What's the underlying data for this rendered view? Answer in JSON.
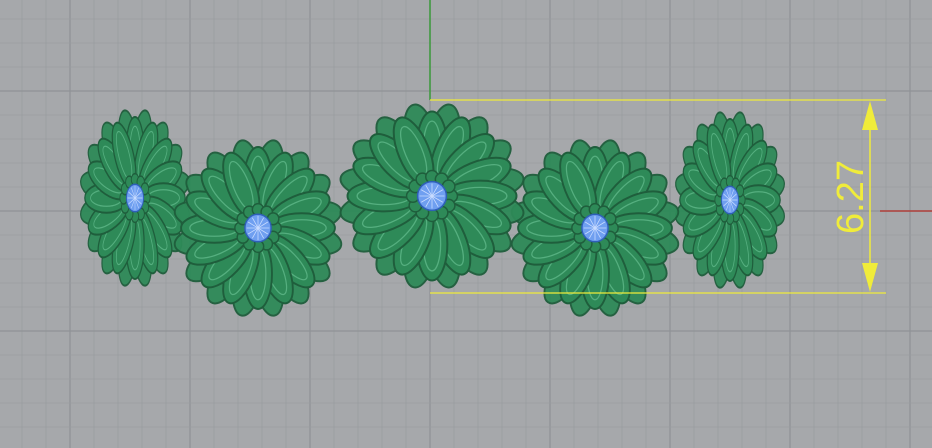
{
  "viewport": {
    "background": "#a6a8ab",
    "grid_minor_color": "#9a9da1",
    "grid_major_color": "#8f9296",
    "axis_x_color": "#b0403a",
    "axis_y_color": "#3a9a3a"
  },
  "model": {
    "description_icon": "flower-ring-model",
    "flower_count": 5,
    "flower_color": "#2e8a58",
    "flower_outline": "#1f5e3c",
    "petal_highlight": "#5fb88a",
    "center_color": "#6f9ff0",
    "center_outline": "#2f5fb8"
  },
  "dimension": {
    "value_text": "6.27",
    "color": "#f0ec3a"
  }
}
